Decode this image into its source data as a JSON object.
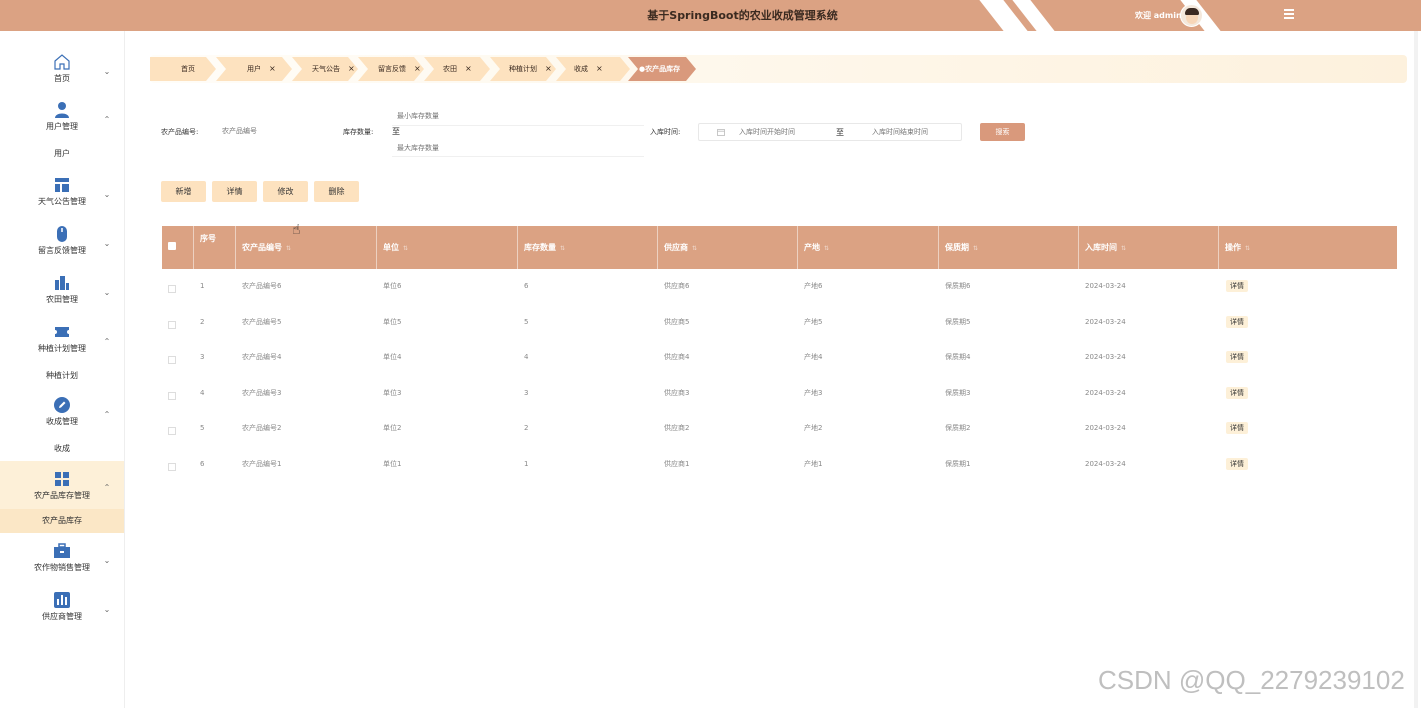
{
  "header": {
    "title": "基于SpringBoot的农业收成管理系统",
    "welcome": "欢迎 admin"
  },
  "sidebar": {
    "items": [
      {
        "label": "首页",
        "icon": "home-icon"
      },
      {
        "label": "用户管理",
        "icon": "user-icon",
        "sub": [
          "用户"
        ]
      },
      {
        "label": "天气公告管理",
        "icon": "layout-icon"
      },
      {
        "label": "留言反馈管理",
        "icon": "mouse-icon"
      },
      {
        "label": "农田管理",
        "icon": "building-icon"
      },
      {
        "label": "种植计划管理",
        "icon": "ticket-icon",
        "sub": [
          "种植计划"
        ]
      },
      {
        "label": "收成管理",
        "icon": "edit-circle-icon",
        "sub": [
          "收成"
        ]
      },
      {
        "label": "农产品库存管理",
        "icon": "grid-icon",
        "sub": [
          "农产品库存"
        ]
      },
      {
        "label": "农作物销售管理",
        "icon": "briefcase-icon"
      },
      {
        "label": "供应商管理",
        "icon": "chart-icon"
      }
    ]
  },
  "tabs": [
    {
      "label": "首页",
      "closable": false
    },
    {
      "label": "用户",
      "closable": true
    },
    {
      "label": "天气公告",
      "closable": true
    },
    {
      "label": "留言反馈",
      "closable": true
    },
    {
      "label": "农田",
      "closable": true
    },
    {
      "label": "种植计划",
      "closable": true
    },
    {
      "label": "收成",
      "closable": true
    },
    {
      "label": "●农产品库存",
      "closable": false
    }
  ],
  "search": {
    "code_label": "农产品编号:",
    "code_placeholder": "农产品编号",
    "stock_label": "库存数量:",
    "stock_min_placeholder": "最小库存数量",
    "stock_to": "至",
    "stock_max_placeholder": "最大库存数量",
    "time_label": "入库时间:",
    "time_start_placeholder": "入库时间开始时间",
    "time_to": "至",
    "time_end_placeholder": "入库时间结束时间",
    "search_button": "搜索"
  },
  "actions": {
    "add": "新增",
    "detail": "详情",
    "edit": "修改",
    "delete": "删除"
  },
  "table": {
    "columns": [
      "序号",
      "农产品编号",
      "单位",
      "库存数量",
      "供应商",
      "产地",
      "保质期",
      "入库时间",
      "操作"
    ],
    "rows": [
      {
        "seq": "1",
        "code": "农产品编号6",
        "unit": "单位6",
        "qty": "6",
        "supplier": "供应商6",
        "origin": "产地6",
        "shelf": "保质期6",
        "date": "2024-03-24",
        "op": "详情"
      },
      {
        "seq": "2",
        "code": "农产品编号5",
        "unit": "单位5",
        "qty": "5",
        "supplier": "供应商5",
        "origin": "产地5",
        "shelf": "保质期5",
        "date": "2024-03-24",
        "op": "详情"
      },
      {
        "seq": "3",
        "code": "农产品编号4",
        "unit": "单位4",
        "qty": "4",
        "supplier": "供应商4",
        "origin": "产地4",
        "shelf": "保质期4",
        "date": "2024-03-24",
        "op": "详情"
      },
      {
        "seq": "4",
        "code": "农产品编号3",
        "unit": "单位3",
        "qty": "3",
        "supplier": "供应商3",
        "origin": "产地3",
        "shelf": "保质期3",
        "date": "2024-03-24",
        "op": "详情"
      },
      {
        "seq": "5",
        "code": "农产品编号2",
        "unit": "单位2",
        "qty": "2",
        "supplier": "供应商2",
        "origin": "产地2",
        "shelf": "保质期2",
        "date": "2024-03-24",
        "op": "详情"
      },
      {
        "seq": "6",
        "code": "农产品编号1",
        "unit": "单位1",
        "qty": "1",
        "supplier": "供应商1",
        "origin": "产地1",
        "shelf": "保质期1",
        "date": "2024-03-24",
        "op": "详情"
      }
    ]
  },
  "watermark": "CSDN @QQ_2279239102",
  "colors": {
    "primary": "#dba283",
    "button_light": "#fde2bf",
    "active_bg": "#fdf0d8"
  }
}
